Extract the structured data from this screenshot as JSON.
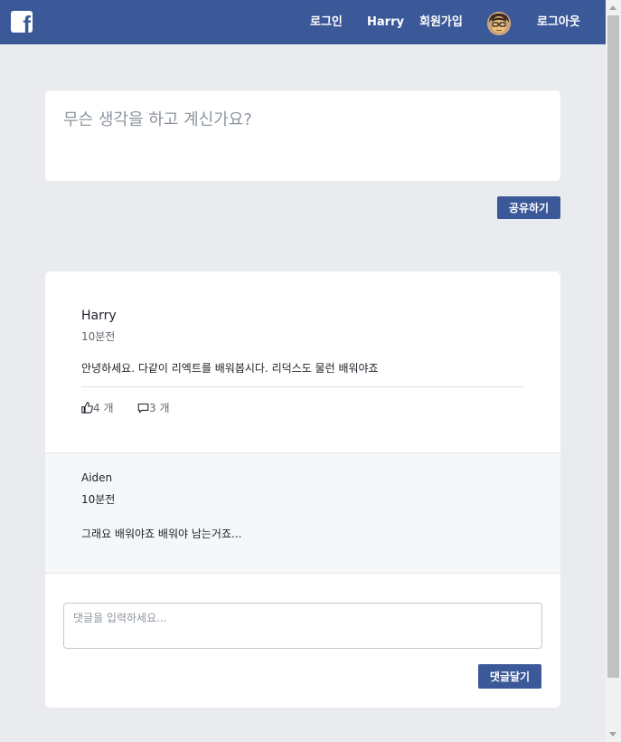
{
  "navbar": {
    "logo_letter": "f",
    "items": [
      {
        "label": "로그인"
      },
      {
        "label": "Harry"
      },
      {
        "label": "회원가입"
      },
      {
        "label": "로그아웃"
      }
    ],
    "color": "#3b5998"
  },
  "composer": {
    "placeholder": "무슨 생각을 하고 계신가요?",
    "share_label": "공유하기"
  },
  "post": {
    "author": "Harry",
    "time": "10분전",
    "content": "안녕하세요. 다같이 리엑트를 배워봅시다. 리덕스도 물런 배워야죠",
    "likes": "4 개",
    "comments": "3 개"
  },
  "comment": {
    "author": "Aiden",
    "time": "10분전",
    "content": "그래요 배워야죠 배워야 남는거죠..."
  },
  "comment_form": {
    "placeholder": "댓글을 입력하세요...",
    "submit_label": "댓글달기"
  }
}
